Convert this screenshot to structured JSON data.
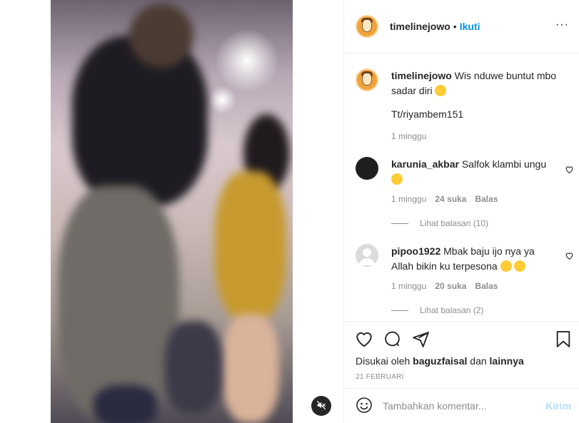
{
  "post": {
    "author": "timelinejowo",
    "follow_label": "Ikuti",
    "more_label": "···",
    "caption": {
      "username": "timelinejowo",
      "text": "Wis nduwe buntut mbo sadar diri",
      "credit": "Tt/riyambem151",
      "time": "1 minggu"
    },
    "comments": [
      {
        "username": "karunia_akbar",
        "text": "Salfok klambi ungu",
        "time": "1 minggu",
        "likes": "24 suka",
        "reply_label": "Balas",
        "view_replies": "Lihat balasan (10)"
      },
      {
        "username": "pipoo1922",
        "text": "Mbak baju ijo nya ya Allah bikin ku terpesona",
        "time": "1 minggu",
        "likes": "20 suka",
        "reply_label": "Balas",
        "view_replies": "Lihat balasan (2)"
      }
    ],
    "liked_by": {
      "prefix": "Disukai oleh",
      "user": "baguzfaisal",
      "conj": "dan",
      "others": "lainnya"
    },
    "date": "21 FEBRUARI",
    "add_comment": {
      "placeholder": "Tambahkan komentar...",
      "post_label": "Kirim"
    }
  },
  "colors": {
    "link": "#0095f6",
    "muted": "#8e8e8e",
    "post_disabled": "#b2dffc"
  },
  "icons": [
    "heart-icon",
    "comment-icon",
    "share-icon",
    "bookmark-icon",
    "emoji-icon",
    "mute-icon",
    "more-icon"
  ]
}
